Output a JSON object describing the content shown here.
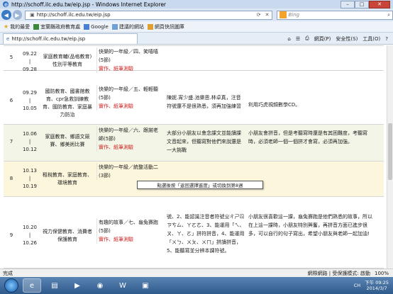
{
  "window": {
    "title": "http://schoff.ilc.edu.tw/eip.jsp - Windows Internet Explorer",
    "minimize": "–",
    "maximize": "□",
    "close": "✕"
  },
  "address": {
    "url": "http://schoff.ilc.edu.tw/eip.jsp",
    "search_placeholder": "Bing"
  },
  "favorites": {
    "label": "我的最愛",
    "items": [
      "宜蘭縣政府教育處",
      "Google",
      "建議的網站",
      "網頁快訊圖庫"
    ]
  },
  "tab": {
    "label": "http://schoff.ilc.edu.tw/eip.jsp"
  },
  "commands": [
    "網頁(P)",
    "安全性(S)",
    "工具(O)"
  ],
  "rows": [
    {
      "num": "5",
      "date_from": "09.22",
      "date_to": "09.28",
      "topic": "家庭教育輔(品格教育)性別平等教育",
      "unit": "快樂的一年級／四、笑嘻嘻(5節)",
      "unit_red": "實作、紙筆測驗",
      "note1": "",
      "note2": ""
    },
    {
      "num": "6",
      "date_from": "09.29",
      "date_to": "10.05",
      "topic": "國防教育、國書館教育、cpr急救訓練教育、國防教育、家庭暴力防治",
      "unit": "快樂的一年級／五、輕輕聽(5節)",
      "unit_red": "實作、紙筆測驗",
      "note1": "陳妮.宵少盛.池樂恩.林卓真，注音符號還不是很熟悉，須再加強練習",
      "note2": "利用巧虎視頻數學CD。"
    },
    {
      "num": "7",
      "date_from": "10.06",
      "date_to": "10.12",
      "topic": "家庭教育、鄉語文競賽、鄉美術比賽",
      "unit": "快樂的一年級／六、跟謝老師(5節)",
      "unit_red": "實作、紙筆測驗",
      "note1": "大部分小朋友以會念課文並能讀課文音起來，但聽寫對他們來說還是一大挑戰",
      "note2": "小朋友會拼音，但是考聽寫時還是有其困難度，考聽寫時，必須老師一個一個拼才會寫，必須再加強。"
    },
    {
      "num": "8",
      "date_from": "10.13",
      "date_to": "10.19",
      "topic": "租稅教育、家庭教育、環境教育",
      "unit": "快樂的一年級／統整活動二(3節)",
      "unit_red": "",
      "note1": "",
      "note2": ""
    },
    {
      "num": "9",
      "date_from": "10.20",
      "date_to": "10.26",
      "topic": "視力保健教育、消費者保護教育",
      "unit": "有趣的故事／七、龜兔賽跑(5節)",
      "unit_red": "實作、紙筆測驗",
      "note1": "號、2、能認識注音者符號ㄓㄔㄕㄖㄗㄘㄙ、ㄚㄛㄜ、3、能運用「ㄟ、ㄡ、ㄚ、ㄛ」拼符拼音，4、能運用「ㄨㄅ、ㄨㄆ、ㄨㄇ」拼讀拼音，5、能聽寫並分辨本課符號。",
      "note2": "小朋友很喜歡這一課，龜兔賽跑是他們熟悉的故事，所以在上這一課時，小朋友特別興奮，再拼音方面已進步很多，可以自行的句子寫出，希望小朋友與老師一起加油!"
    }
  ],
  "tooltip": "點選後按「返回選擇進度」或切換到第8週",
  "status": {
    "left": "完成",
    "right": "網際網路 | 受保護模式: 啟動",
    "zoom": "100%"
  },
  "taskbar": {
    "lang": "CH",
    "time": "下午 09:25",
    "date": "2014/3/7"
  }
}
